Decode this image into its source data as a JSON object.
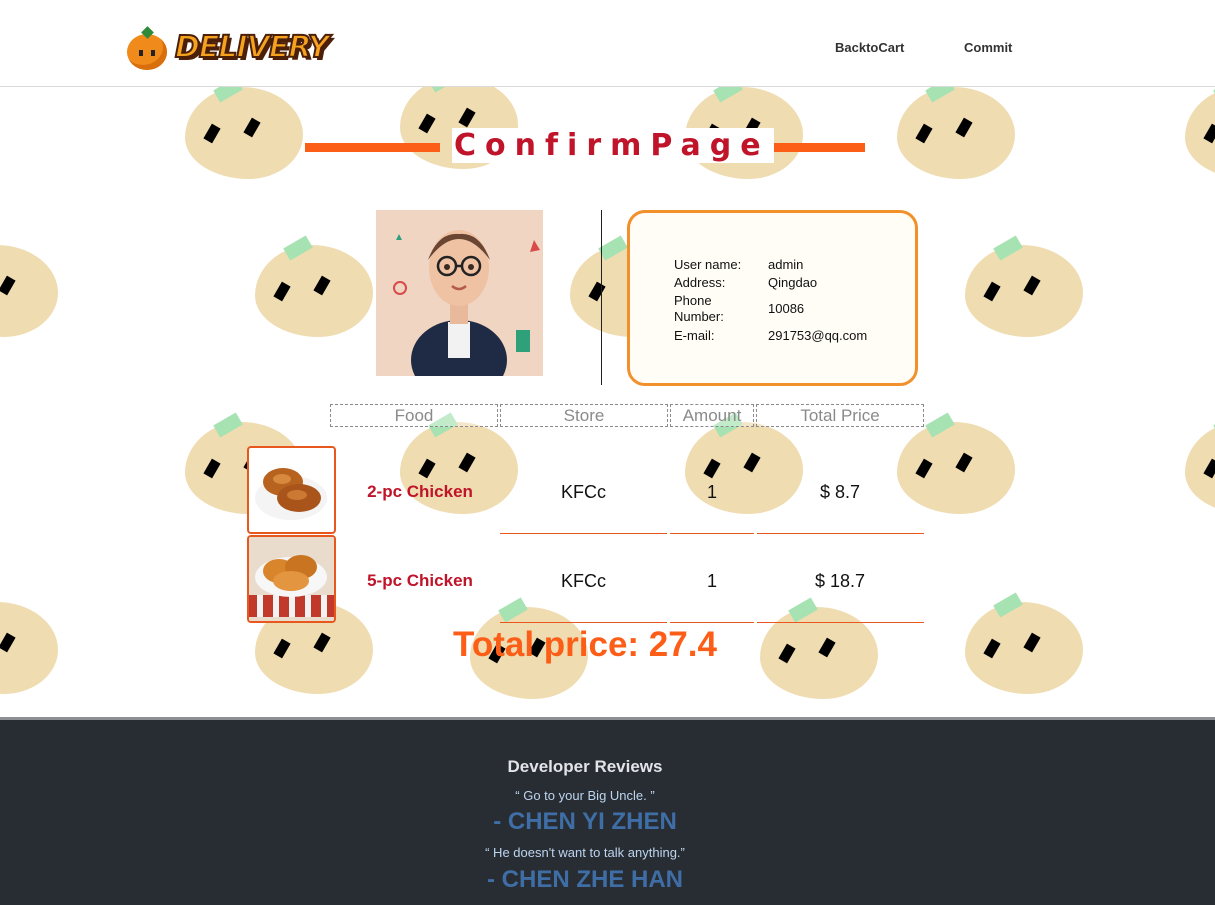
{
  "header": {
    "logo_text": "DELIVERY",
    "nav": {
      "back_label": "BacktoCart",
      "commit_label": "Commit"
    }
  },
  "page": {
    "title": "ConfirmPage"
  },
  "user": {
    "username_label": "User name:",
    "username": "admin",
    "address_label": "Address:",
    "address": "Qingdao",
    "phone_label": "Phone Number:",
    "phone": "10086",
    "email_label": "E-mail:",
    "email": "291753@qq.com"
  },
  "table": {
    "headers": [
      "Food",
      "Store",
      "Amount",
      "Total Price"
    ],
    "rows": [
      {
        "name": "2-pc Chicken",
        "store": "KFCc",
        "amount": "1",
        "price": "$ 8.7"
      },
      {
        "name": "5-pc Chicken",
        "store": "KFCc",
        "amount": "1",
        "price": "$ 18.7"
      }
    ]
  },
  "total": "Total price: 27.4",
  "footer": {
    "title": "Developer Reviews",
    "reviews": [
      {
        "quote": "“ Go to your Big Uncle. ”",
        "author": "- CHEN YI ZHEN"
      },
      {
        "quote": "“ He doesn't want to talk anything.”",
        "author": "- CHEN ZHE HAN"
      }
    ]
  },
  "colors": {
    "accent": "#fc5d17",
    "title": "#c0142a",
    "footer_bg": "#282d34"
  }
}
